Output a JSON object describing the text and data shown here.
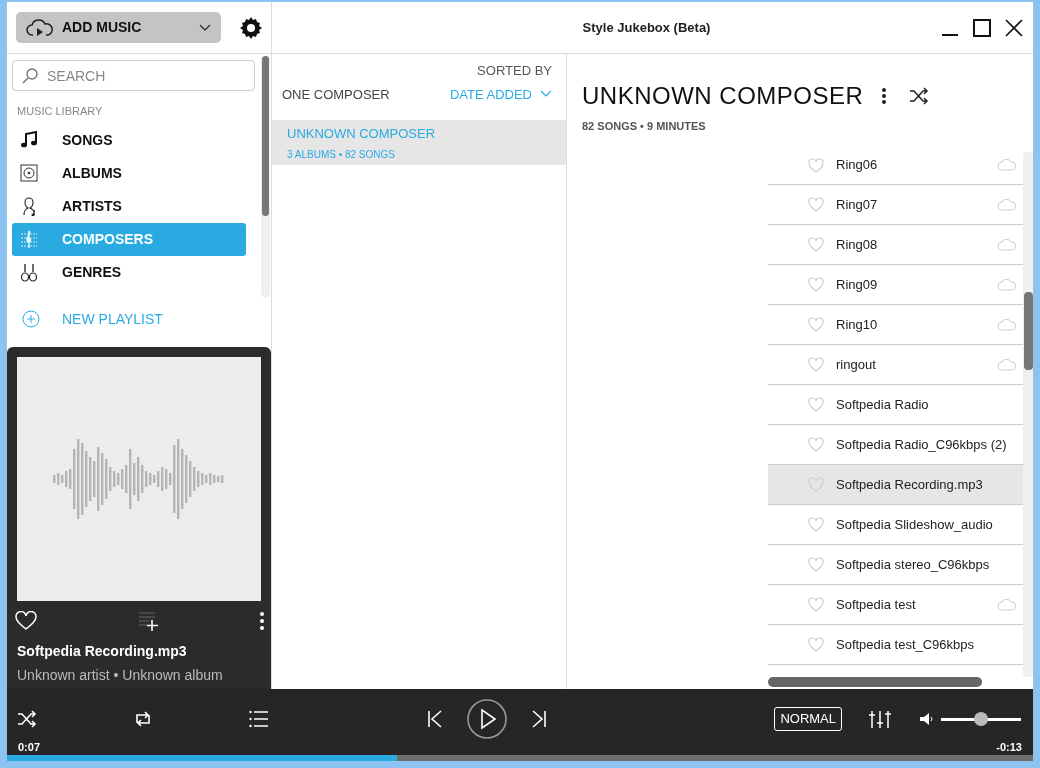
{
  "toolbar": {
    "add_button": "ADD MUSIC"
  },
  "window": {
    "title": "Style Jukebox (Beta)"
  },
  "search": {
    "placeholder": "SEARCH"
  },
  "library": {
    "heading": "MUSIC LIBRARY",
    "items": [
      {
        "label": "SONGS",
        "selected": false
      },
      {
        "label": "ALBUMS",
        "selected": false
      },
      {
        "label": "ARTISTS",
        "selected": false
      },
      {
        "label": "COMPOSERS",
        "selected": true
      },
      {
        "label": "GENRES",
        "selected": false
      }
    ],
    "new_playlist": "NEW PLAYLIST"
  },
  "now_playing": {
    "title": "Softpedia Recording.mp3",
    "subtitle": "Unknown artist • Unknown album"
  },
  "composers": {
    "count_label": "ONE COMPOSER",
    "sorted_by_label": "SORTED BY",
    "sort_value": "DATE ADDED",
    "items": [
      {
        "name": "UNKNOWN COMPOSER",
        "meta": "3 ALBUMS • 82 SONGS",
        "selected": true
      }
    ]
  },
  "detail": {
    "title": "UNKNOWN COMPOSER",
    "meta": "82 SONGS • 9 MINUTES",
    "songs": [
      {
        "title": "Ring06",
        "cloud": true,
        "selected": false
      },
      {
        "title": "Ring07",
        "cloud": true,
        "selected": false
      },
      {
        "title": "Ring08",
        "cloud": true,
        "selected": false
      },
      {
        "title": "Ring09",
        "cloud": true,
        "selected": false
      },
      {
        "title": "Ring10",
        "cloud": true,
        "selected": false
      },
      {
        "title": "ringout",
        "cloud": true,
        "selected": false
      },
      {
        "title": "Softpedia Radio",
        "cloud": false,
        "selected": false
      },
      {
        "title": "Softpedia Radio_C96kbps (2)",
        "cloud": false,
        "selected": false
      },
      {
        "title": "Softpedia Recording.mp3",
        "cloud": false,
        "selected": true
      },
      {
        "title": "Softpedia Slideshow_audio",
        "cloud": false,
        "selected": false
      },
      {
        "title": "Softpedia stereo_C96kbps",
        "cloud": false,
        "selected": false
      },
      {
        "title": "Softpedia test",
        "cloud": true,
        "selected": false
      },
      {
        "title": "Softpedia test_C96kbps",
        "cloud": false,
        "selected": false
      }
    ]
  },
  "player": {
    "mode": "NORMAL",
    "elapsed": "0:07",
    "remaining": "-0:13",
    "progress": {
      "level": 0.38
    },
    "volume": {
      "level": 0.5
    }
  }
}
